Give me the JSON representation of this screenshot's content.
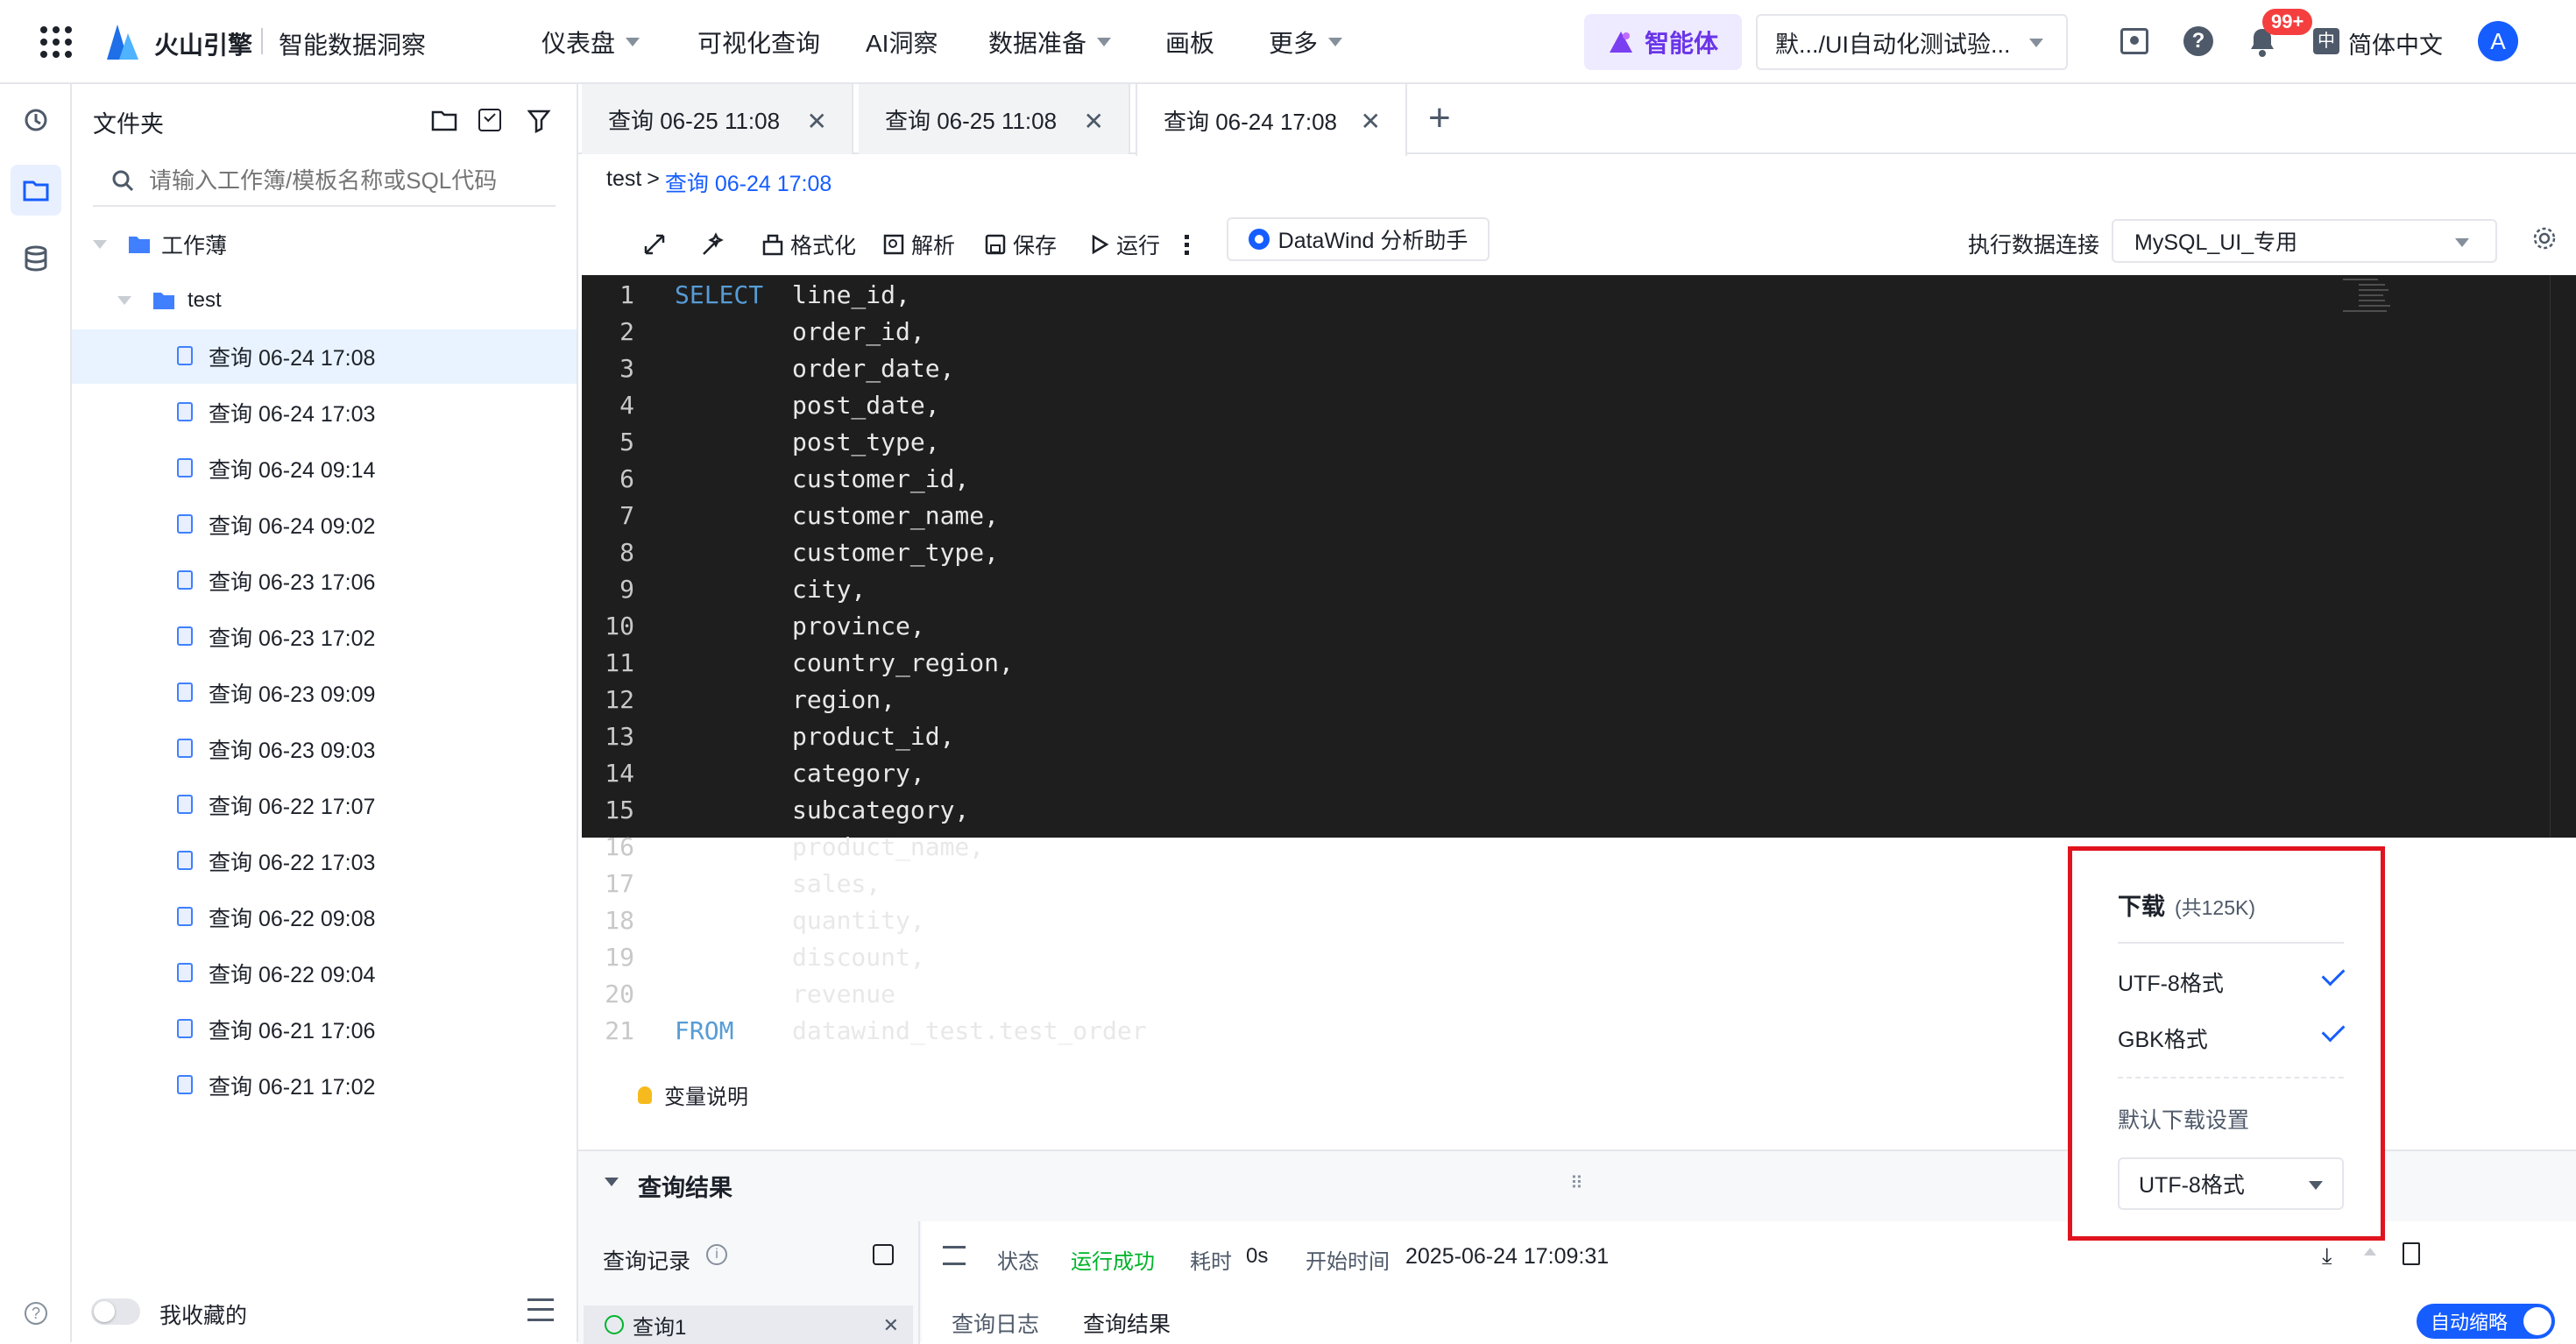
{
  "topbar": {
    "brand": "火山引擎",
    "product": "智能数据洞察",
    "nav": [
      "仪表盘",
      "可视化查询",
      "AI洞察",
      "数据准备",
      "画板",
      "更多"
    ],
    "agent_label": "智能体",
    "project_select": "默.../UI自动化测试验...",
    "notif_badge": "99+",
    "language": "简体中文",
    "avatar_letter": "A"
  },
  "sidebar": {
    "title": "文件夹",
    "search_placeholder": "请输入工作簿/模板名称或SQL代码",
    "root_folder": "工作薄",
    "sub_folder": "test",
    "items": [
      "查询 06-24 17:08",
      "查询 06-24 17:03",
      "查询 06-24 09:14",
      "查询 06-24 09:02",
      "查询 06-23 17:06",
      "查询 06-23 17:02",
      "查询 06-23 09:09",
      "查询 06-23 09:03",
      "查询 06-22 17:07",
      "查询 06-22 17:03",
      "查询 06-22 09:08",
      "查询 06-22 09:04",
      "查询 06-21 17:06",
      "查询 06-21 17:02"
    ],
    "favorites_label": "我收藏的"
  },
  "tabs": [
    "查询 06-25 11:08",
    "查询 06-25 11:08",
    "查询 06-24 17:08"
  ],
  "breadcrumb": {
    "parent": "test",
    "current": "查询 06-24 17:08"
  },
  "toolbar": {
    "format": "格式化",
    "parse": "解析",
    "save": "保存",
    "run": "运行",
    "assistant": "DataWind 分析助手",
    "connection_label": "执行数据连接",
    "connection_value": "MySQL_UI_专用"
  },
  "editor": {
    "lines": [
      {
        "kw": "SELECT",
        "text": "line_id,"
      },
      {
        "kw": "",
        "text": "order_id,"
      },
      {
        "kw": "",
        "text": "order_date,"
      },
      {
        "kw": "",
        "text": "post_date,"
      },
      {
        "kw": "",
        "text": "post_type,"
      },
      {
        "kw": "",
        "text": "customer_id,"
      },
      {
        "kw": "",
        "text": "customer_name,"
      },
      {
        "kw": "",
        "text": "customer_type,"
      },
      {
        "kw": "",
        "text": "city,"
      },
      {
        "kw": "",
        "text": "province,"
      },
      {
        "kw": "",
        "text": "country_region,"
      },
      {
        "kw": "",
        "text": "region,"
      },
      {
        "kw": "",
        "text": "product_id,"
      },
      {
        "kw": "",
        "text": "category,"
      },
      {
        "kw": "",
        "text": "subcategory,"
      },
      {
        "kw": "",
        "text": "product_name,"
      },
      {
        "kw": "",
        "text": "sales,"
      },
      {
        "kw": "",
        "text": "quantity,"
      },
      {
        "kw": "",
        "text": "discount,"
      },
      {
        "kw": "",
        "text": "revenue"
      },
      {
        "kw": "FROM",
        "text": "datawind_test.test_order"
      }
    ]
  },
  "variables_label": "变量说明",
  "results": {
    "title": "查询结果",
    "history_label": "查询记录",
    "query_item": "查询1",
    "status_label": "状态",
    "status_value": "运行成功",
    "duration_label": "耗时",
    "duration_value": "0s",
    "start_label": "开始时间",
    "start_value": "2025-06-24 17:09:31",
    "tab_log": "查询日志",
    "tab_result": "查询结果",
    "auto_shrink": "自动缩略"
  },
  "download_menu": {
    "title": "下载",
    "size": "(共125K)",
    "opt_utf8": "UTF-8格式",
    "opt_gbk": "GBK格式",
    "default_label": "默认下载设置",
    "default_value": "UTF-8格式"
  },
  "colors": {
    "accent": "#165dff",
    "success": "#00b42a",
    "highlight_border": "#e0141e",
    "editor_bg": "#1e1e1e",
    "keyword": "#569cd6"
  }
}
